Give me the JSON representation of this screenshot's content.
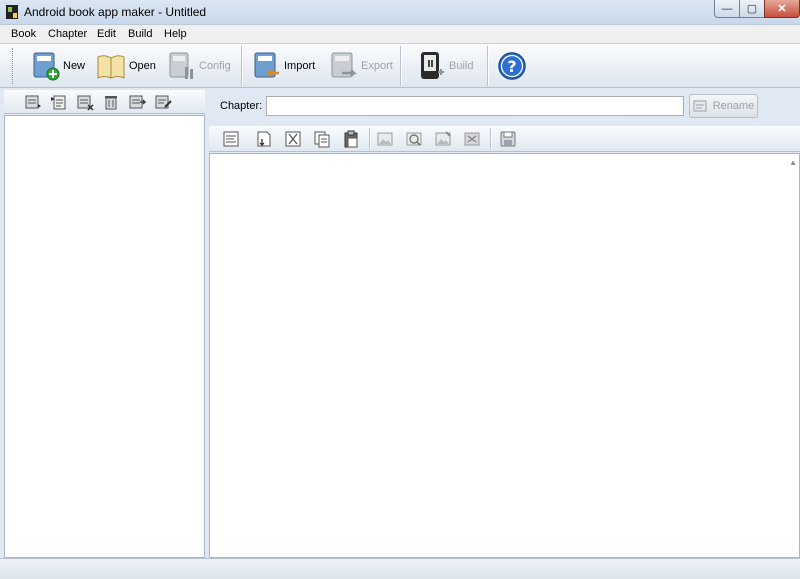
{
  "window": {
    "title": "Android book app maker - Untitled"
  },
  "menu": {
    "items": [
      "Book",
      "Chapter",
      "Edit",
      "Build",
      "Help"
    ]
  },
  "toolbar": {
    "new_label": "New",
    "open_label": "Open",
    "config_label": "Config",
    "import_label": "Import",
    "export_label": "Export",
    "build_label": "Build"
  },
  "left_toolbar": {
    "icons": [
      "add-chapter-icon",
      "insert-chapter-icon",
      "remove-chapter-icon",
      "delete-chapter-icon",
      "move-chapter-icon",
      "edit-chapter-icon"
    ]
  },
  "chapter": {
    "label": "Chapter:",
    "value": "",
    "rename_label": "Rename"
  },
  "editor_toolbar": {
    "icons": [
      "format-text-icon",
      "cut-icon",
      "scissors-icon",
      "copy-icon",
      "paste-icon",
      "insert-image-icon",
      "zoom-image-icon",
      "edit-image-icon",
      "delete-image-icon",
      "save-icon"
    ]
  },
  "colors": {
    "chrome": "#dfe8f3",
    "toolbar": "#eef2f7",
    "close_button": "#c8503a",
    "help_blue": "#2f6fd1",
    "new_green": "#2fa83a"
  }
}
